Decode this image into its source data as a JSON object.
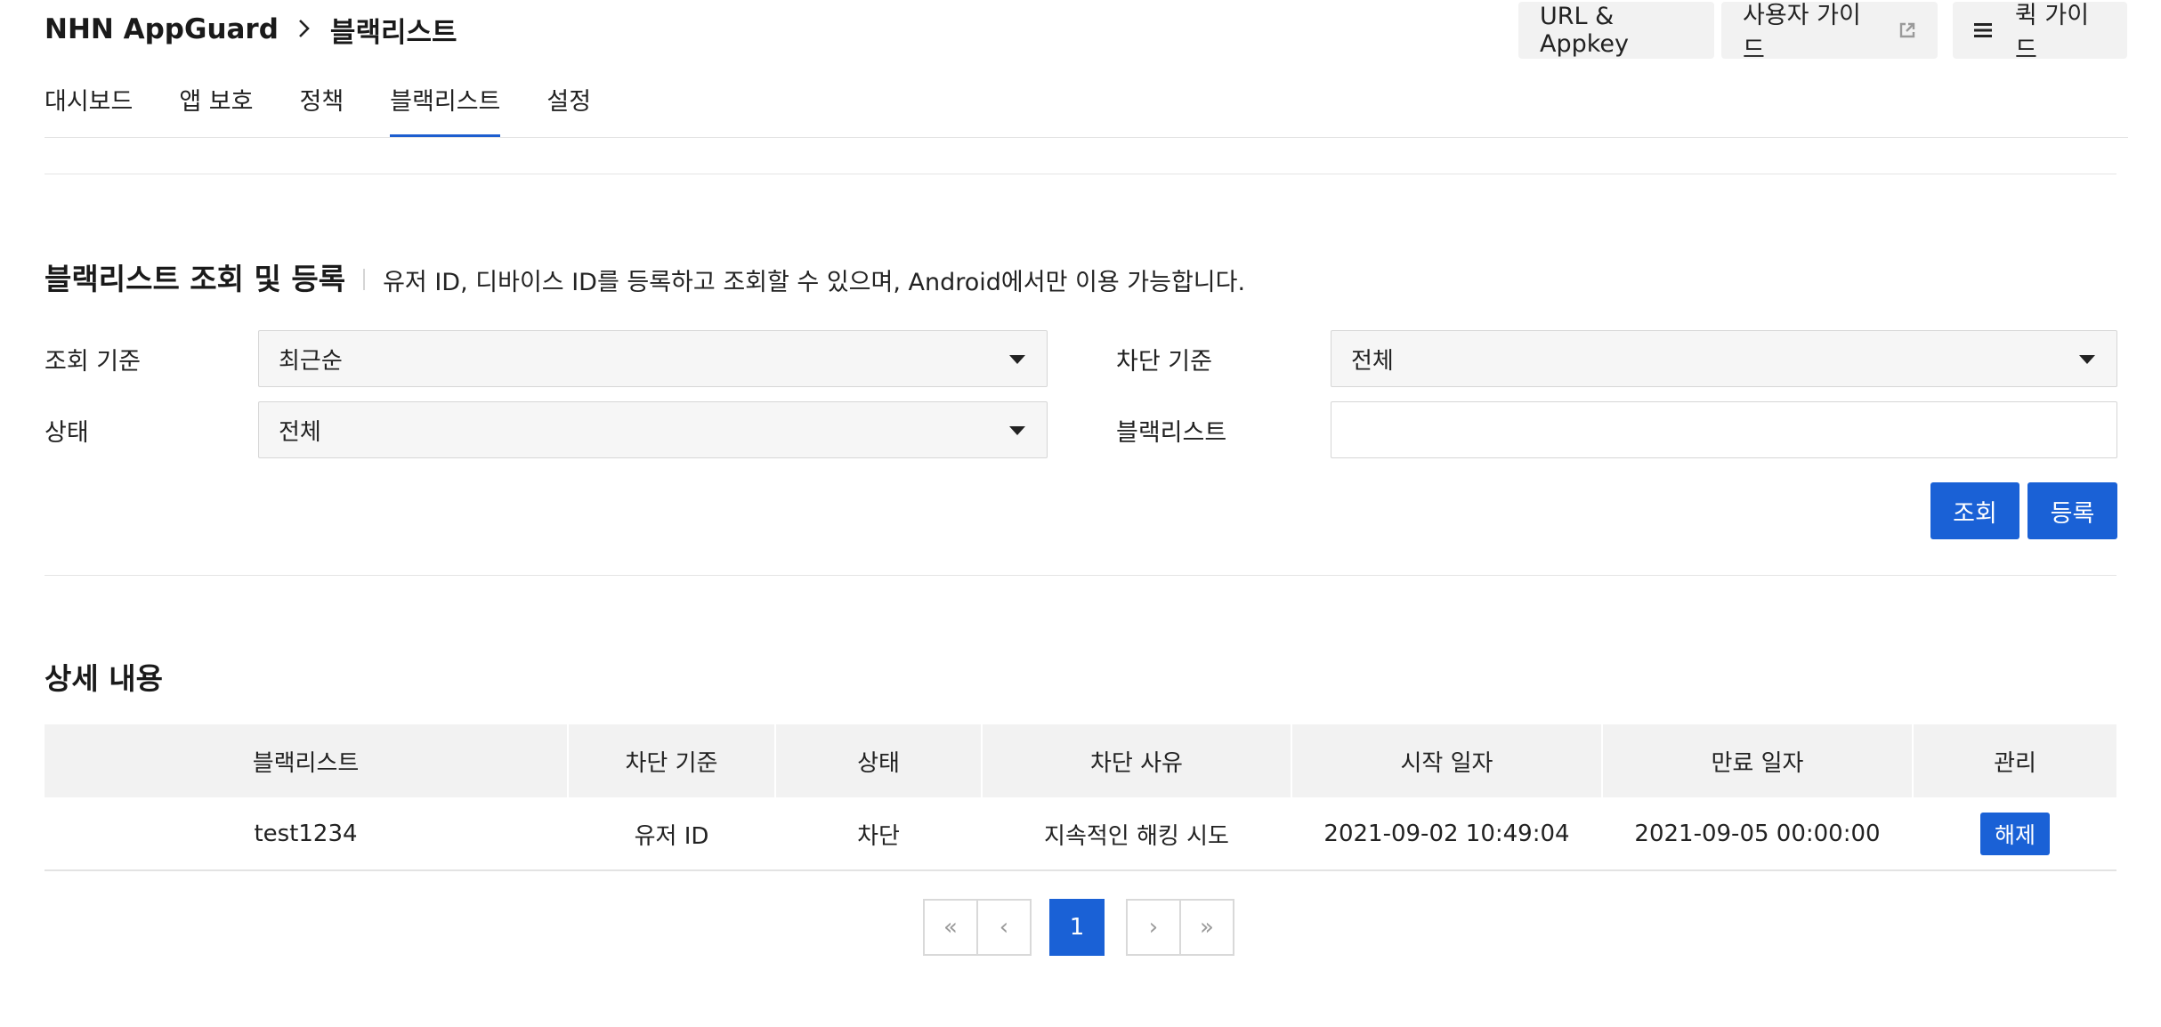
{
  "header": {
    "app_name": "NHN AppGuard",
    "separator": ">",
    "current_page": "블랙리스트",
    "buttons": {
      "url_appkey": "URL & Appkey",
      "user_guide": "사용자 가이드",
      "quick_guide": "퀵 가이드"
    }
  },
  "tabs": [
    {
      "label": "대시보드",
      "active": false
    },
    {
      "label": "앱 보호",
      "active": false
    },
    {
      "label": "정책",
      "active": false
    },
    {
      "label": "블랙리스트",
      "active": true
    },
    {
      "label": "설정",
      "active": false
    }
  ],
  "search_section": {
    "title": "블랙리스트 조회 및 등록",
    "description": "유저 ID, 디바이스 ID를 등록하고 조회할 수 있으며, Android에서만 이용 가능합니다.",
    "fields": {
      "sort_label": "조회 기준",
      "sort_value": "최근순",
      "block_type_label": "차단 기준",
      "block_type_value": "전체",
      "status_label": "상태",
      "status_value": "전체",
      "blacklist_label": "블랙리스트",
      "blacklist_value": ""
    },
    "buttons": {
      "search": "조회",
      "register": "등록"
    }
  },
  "detail_section": {
    "title": "상세 내용",
    "columns": [
      "블랙리스트",
      "차단 기준",
      "상태",
      "차단 사유",
      "시작 일자",
      "만료 일자",
      "관리"
    ],
    "rows": [
      {
        "blacklist": "test1234",
        "block_type": "유저 ID",
        "status": "차단",
        "reason": "지속적인 해킹 시도",
        "start_date": "2021-09-02 10:49:04",
        "end_date": "2021-09-05 00:00:00",
        "action": "해제"
      }
    ]
  },
  "pagination": {
    "first": "«",
    "prev": "‹",
    "current_page": "1",
    "next": "›",
    "last": "»"
  },
  "colors": {
    "accent": "#1a61d6",
    "header_bg": "#f2f2f2"
  }
}
